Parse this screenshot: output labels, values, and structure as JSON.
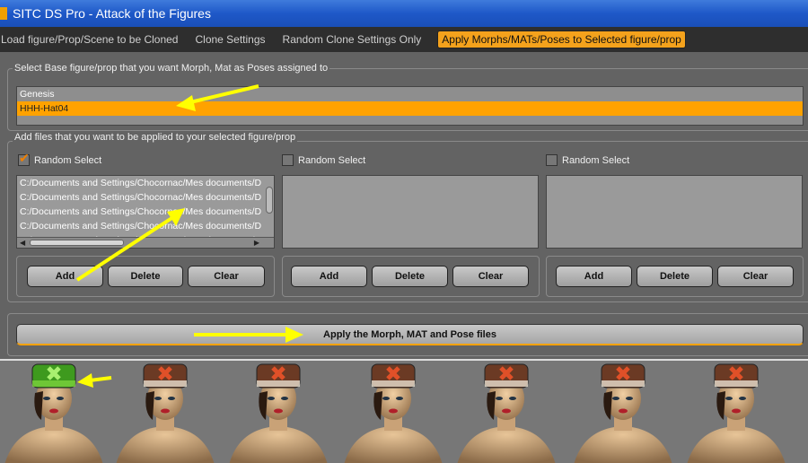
{
  "window": {
    "title": "SITC DS Pro - Attack of the Figures"
  },
  "tabs": [
    {
      "label": "Load figure/Prop/Scene to be Cloned",
      "active": false
    },
    {
      "label": "Clone Settings",
      "active": false
    },
    {
      "label": "Random Clone Settings Only",
      "active": false
    },
    {
      "label": "Apply Morphs/MATs/Poses to Selected figure/prop",
      "active": true
    }
  ],
  "base_section": {
    "legend": "Select Base figure/prop that you want Morph, Mat as Poses assigned to",
    "items": [
      "Genesis",
      "HHH-Hat04"
    ],
    "selected_index": 1
  },
  "files_section": {
    "legend": "Add files that you want to be applied to your selected figure/prop",
    "columns": [
      {
        "random_label": "Random Select",
        "random_checked": true,
        "files": [
          "C:/Documents and Settings/Chocornac/Mes documents/D",
          "C:/Documents and Settings/Chocornac/Mes documents/D",
          "C:/Documents and Settings/Chocornac/Mes documents/D",
          "C:/Documents and Settings/Chocornac/Mes documents/D",
          "C:/Documents and Settings/Chocornac/Mes documents/D"
        ],
        "add": "Add",
        "delete": "Delete",
        "clear": "Clear"
      },
      {
        "random_label": "Random Select",
        "random_checked": false,
        "files": [],
        "add": "Add",
        "delete": "Delete",
        "clear": "Clear"
      },
      {
        "random_label": "Random Select",
        "random_checked": false,
        "files": [],
        "add": "Add",
        "delete": "Delete",
        "clear": "Clear"
      }
    ]
  },
  "apply_button": "Apply the Morph, MAT and Pose files",
  "colors": {
    "accent": "#ffa200",
    "arrow": "#ffff00",
    "titlebar": "#1e58c8"
  },
  "preview": {
    "figure_count": 7,
    "highlighted_index": 0
  }
}
